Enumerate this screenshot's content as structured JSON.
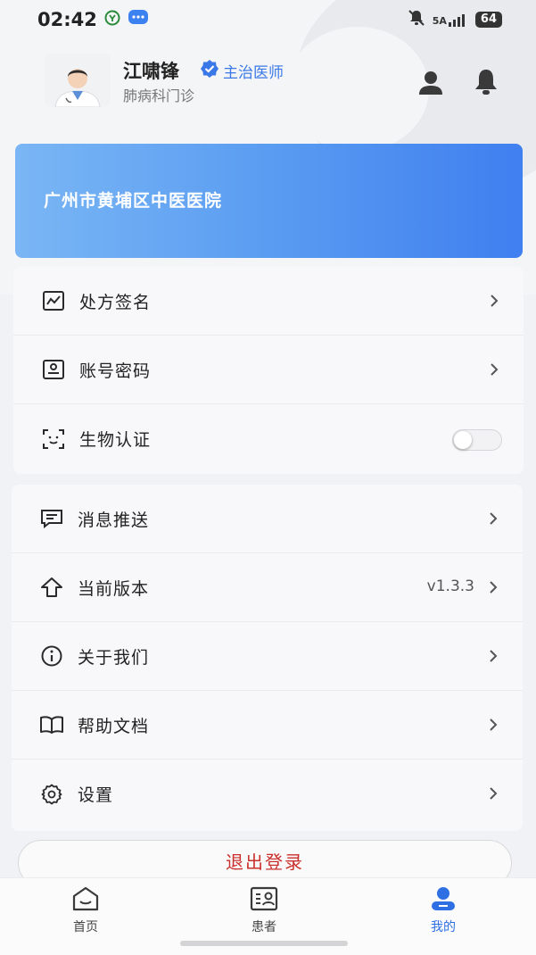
{
  "status_bar": {
    "time": "02:42",
    "signal": "5A",
    "battery": "64"
  },
  "profile": {
    "name": "江啸锋",
    "title": "主治医师",
    "department": "肺病科门诊",
    "verified_icon": "verified-badge-icon",
    "avatar": "doctor-avatar"
  },
  "banner": {
    "hospital": "广州市黄埔区中医医院"
  },
  "menu_group_1": [
    {
      "label": "处方签名",
      "icon": "signature-icon"
    },
    {
      "label": "账号密码",
      "icon": "id-card-icon"
    },
    {
      "label": "生物认证",
      "icon": "face-scan-icon",
      "toggle": false
    }
  ],
  "menu_group_2": [
    {
      "label": "消息推送",
      "icon": "message-icon"
    },
    {
      "label": "当前版本",
      "icon": "upgrade-icon",
      "value": "v1.3.3"
    },
    {
      "label": "关于我们",
      "icon": "info-icon"
    },
    {
      "label": "帮助文档",
      "icon": "book-icon"
    },
    {
      "label": "设置",
      "icon": "gear-icon"
    }
  ],
  "logout_label": "退出登录",
  "tabs": [
    {
      "label": "首页",
      "icon": "home-icon",
      "active": false
    },
    {
      "label": "患者",
      "icon": "patient-icon",
      "active": false
    },
    {
      "label": "我的",
      "icon": "profile-icon",
      "active": true
    }
  ],
  "colors": {
    "accent": "#2f6fe4",
    "logout": "#c9302c",
    "banner_start": "#7ab6f5",
    "banner_end": "#3f7ff0"
  }
}
